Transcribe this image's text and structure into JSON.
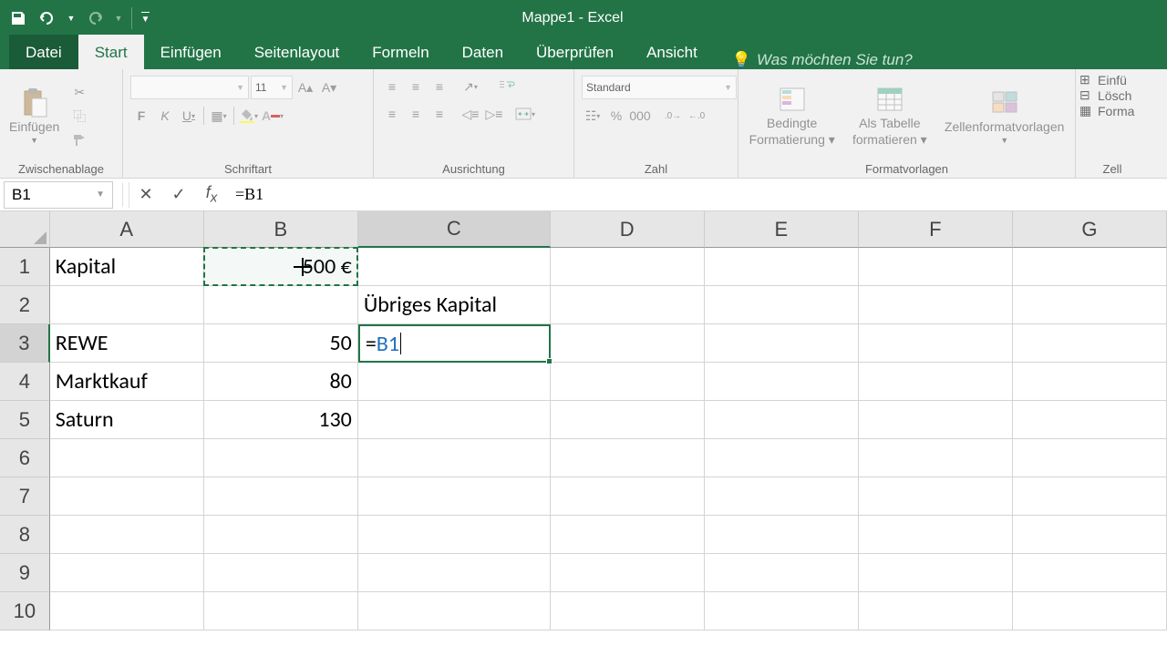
{
  "app": {
    "title": "Mappe1 - Excel"
  },
  "tabs": {
    "datei": "Datei",
    "start": "Start",
    "einfuegen": "Einfügen",
    "seitenlayout": "Seitenlayout",
    "formeln": "Formeln",
    "daten": "Daten",
    "ueberpruefen": "Überprüfen",
    "ansicht": "Ansicht",
    "tellme": "Was möchten Sie tun?"
  },
  "ribbon": {
    "paste": "Einfügen",
    "clipboard": "Zwischenablage",
    "font_name": "",
    "font_size": "11",
    "font_group": "Schriftart",
    "align_group": "Ausrichtung",
    "number_format": "Standard",
    "number_group": "Zahl",
    "cond_fmt1": "Bedingte",
    "cond_fmt2": "Formatierung",
    "as_table1": "Als Tabelle",
    "as_table2": "formatieren",
    "cell_styles": "Zellenformatvorlagen",
    "styles_group": "Formatvorlagen",
    "insert_c": "Einfü",
    "delete_c": "Lösch",
    "format_c": "Forma",
    "cells_group": "Zell"
  },
  "fbar": {
    "namebox": "B1",
    "formula": "=B1"
  },
  "cols": [
    "A",
    "B",
    "C",
    "D",
    "E",
    "F",
    "G"
  ],
  "rows": [
    "1",
    "2",
    "3",
    "4",
    "5",
    "6",
    "7",
    "8",
    "9",
    "10"
  ],
  "cells": {
    "A1": "Kapital",
    "B1": "500 €",
    "C2": "Übriges Kapital",
    "A3": "REWE",
    "B3": "50",
    "C3_eq": "=",
    "C3_ref": "B1",
    "A4": "Marktkauf",
    "B4": "80",
    "A5": "Saturn",
    "B5": "130"
  }
}
